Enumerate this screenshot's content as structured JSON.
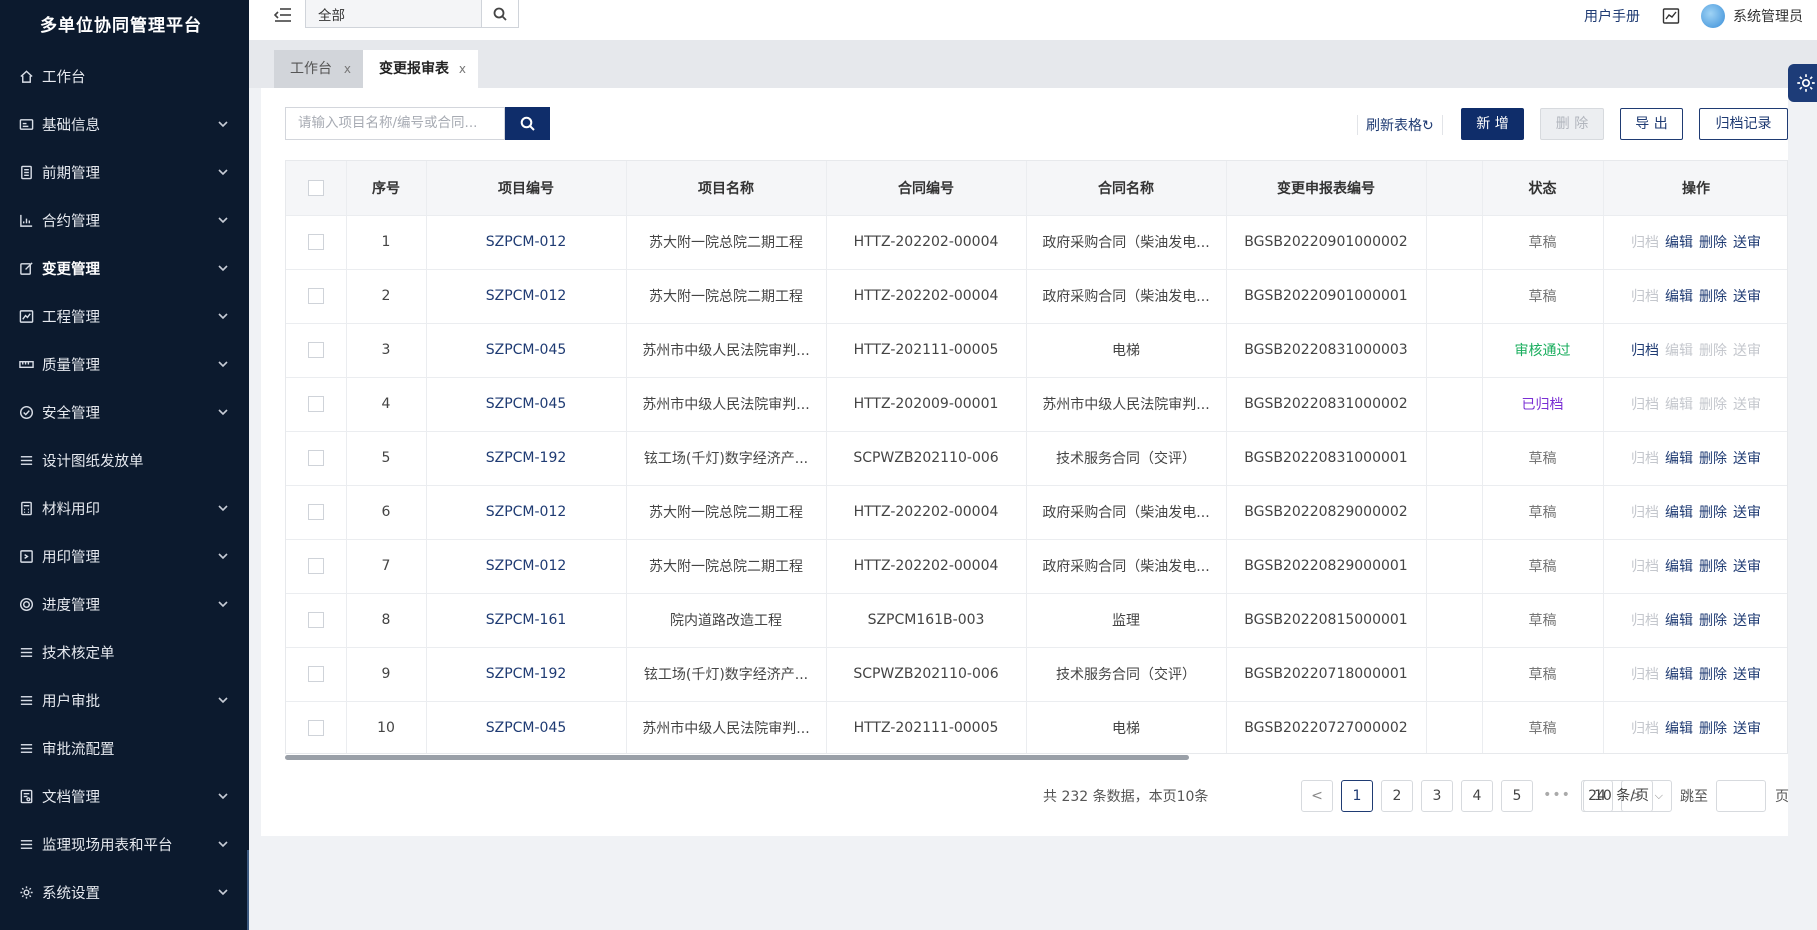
{
  "sidebar": {
    "brand": "多单位协同管理平台",
    "items": [
      {
        "label": "工作台",
        "icon": "home-icon",
        "has_children": false
      },
      {
        "label": "基础信息",
        "icon": "id-card-icon",
        "has_children": true
      },
      {
        "label": "前期管理",
        "icon": "document-icon",
        "has_children": true
      },
      {
        "label": "合约管理",
        "icon": "bar-chart-icon",
        "has_children": true
      },
      {
        "label": "变更管理",
        "icon": "edit-icon",
        "has_children": true,
        "active": true
      },
      {
        "label": "工程管理",
        "icon": "line-chart-icon",
        "has_children": true
      },
      {
        "label": "质量管理",
        "icon": "ruler-icon",
        "has_children": true
      },
      {
        "label": "安全管理",
        "icon": "check-circle-icon",
        "has_children": true
      },
      {
        "label": "设计图纸发放单",
        "icon": "list-icon",
        "has_children": false
      },
      {
        "label": "材料用印",
        "icon": "calculator-icon",
        "has_children": true
      },
      {
        "label": "用印管理",
        "icon": "stamp-icon",
        "has_children": true
      },
      {
        "label": "进度管理",
        "icon": "target-icon",
        "has_children": true
      },
      {
        "label": "技术核定单",
        "icon": "list-icon",
        "has_children": false
      },
      {
        "label": "用户审批",
        "icon": "list-icon",
        "has_children": true
      },
      {
        "label": "审批流配置",
        "icon": "list-icon",
        "has_children": false
      },
      {
        "label": "文档管理",
        "icon": "file-icon",
        "has_children": true
      },
      {
        "label": "监理现场用表和平台",
        "icon": "list-icon",
        "has_children": true
      },
      {
        "label": "系统设置",
        "icon": "gear-icon",
        "has_children": true
      }
    ]
  },
  "header": {
    "search_scope": "全部",
    "manual": "用户手册",
    "user_name": "系统管理员"
  },
  "tabs": [
    {
      "label": "工作台",
      "close": "x"
    },
    {
      "label": "变更报审表",
      "close": "x"
    }
  ],
  "toolbar": {
    "search_placeholder": "请输入项目名称/编号或合同...",
    "refresh": "刷新表格",
    "add": "新 增",
    "delete": "删 除",
    "export": "导 出",
    "archive_records": "归档记录"
  },
  "table": {
    "columns": [
      "序号",
      "项目编号",
      "项目名称",
      "合同编号",
      "合同名称",
      "变更申报表编号",
      "状态",
      "操作"
    ],
    "actions": [
      "归档",
      "编辑",
      "删除",
      "送审"
    ],
    "rows": [
      {
        "no": "1",
        "project_code": "SZPCM-012",
        "project_name": "苏大附一院总院二期工程",
        "contract_code": "HTTZ-202202-00004",
        "contract_name": "政府采购合同（柴油发电...",
        "report_code": "BGSB20220901000002",
        "status": "草稿",
        "status_type": "draft"
      },
      {
        "no": "2",
        "project_code": "SZPCM-012",
        "project_name": "苏大附一院总院二期工程",
        "contract_code": "HTTZ-202202-00004",
        "contract_name": "政府采购合同（柴油发电...",
        "report_code": "BGSB20220901000001",
        "status": "草稿",
        "status_type": "draft"
      },
      {
        "no": "3",
        "project_code": "SZPCM-045",
        "project_name": "苏州市中级人民法院审判...",
        "contract_code": "HTTZ-202111-00005",
        "contract_name": "电梯",
        "report_code": "BGSB20220831000003",
        "status": "审核通过",
        "status_type": "pass"
      },
      {
        "no": "4",
        "project_code": "SZPCM-045",
        "project_name": "苏州市中级人民法院审判...",
        "contract_code": "HTTZ-202009-00001",
        "contract_name": "苏州市中级人民法院审判...",
        "report_code": "BGSB20220831000002",
        "status": "已归档",
        "status_type": "archived"
      },
      {
        "no": "5",
        "project_code": "SZPCM-192",
        "project_name": "铉工场(千灯)数字经济产...",
        "contract_code": "SCPWZB202110-006",
        "contract_name": "技术服务合同（交评）",
        "report_code": "BGSB20220831000001",
        "status": "草稿",
        "status_type": "draft"
      },
      {
        "no": "6",
        "project_code": "SZPCM-012",
        "project_name": "苏大附一院总院二期工程",
        "contract_code": "HTTZ-202202-00004",
        "contract_name": "政府采购合同（柴油发电...",
        "report_code": "BGSB20220829000002",
        "status": "草稿",
        "status_type": "draft"
      },
      {
        "no": "7",
        "project_code": "SZPCM-012",
        "project_name": "苏大附一院总院二期工程",
        "contract_code": "HTTZ-202202-00004",
        "contract_name": "政府采购合同（柴油发电...",
        "report_code": "BGSB20220829000001",
        "status": "草稿",
        "status_type": "draft"
      },
      {
        "no": "8",
        "project_code": "SZPCM-161",
        "project_name": "院内道路改造工程",
        "contract_code": "SZPCM161B-003",
        "contract_name": "监理",
        "report_code": "BGSB20220815000001",
        "status": "草稿",
        "status_type": "draft"
      },
      {
        "no": "9",
        "project_code": "SZPCM-192",
        "project_name": "铉工场(千灯)数字经济产...",
        "contract_code": "SCPWZB202110-006",
        "contract_name": "技术服务合同（交评）",
        "report_code": "BGSB20220718000001",
        "status": "草稿",
        "status_type": "draft"
      },
      {
        "no": "10",
        "project_code": "SZPCM-045",
        "project_name": "苏州市中级人民法院审判...",
        "contract_code": "HTTZ-202111-00005",
        "contract_name": "电梯",
        "report_code": "BGSB20220727000002",
        "status": "草稿",
        "status_type": "draft"
      }
    ]
  },
  "pagination": {
    "summary": "共 232 条数据，本页10条",
    "prev": "<",
    "pages": [
      "1",
      "2",
      "3",
      "4",
      "5"
    ],
    "ellipsis": "•••",
    "last_page": "24",
    "next": ">",
    "current": "1",
    "page_size": "10 条/页",
    "jump_label": "跳至",
    "page_unit": "页"
  },
  "colors": {
    "sidebar_bg": "#0c1a2e",
    "primary": "#0f2d6a",
    "link": "#1f3b73",
    "status_pass": "#1aae5e",
    "status_archived": "#7a2fd4"
  }
}
